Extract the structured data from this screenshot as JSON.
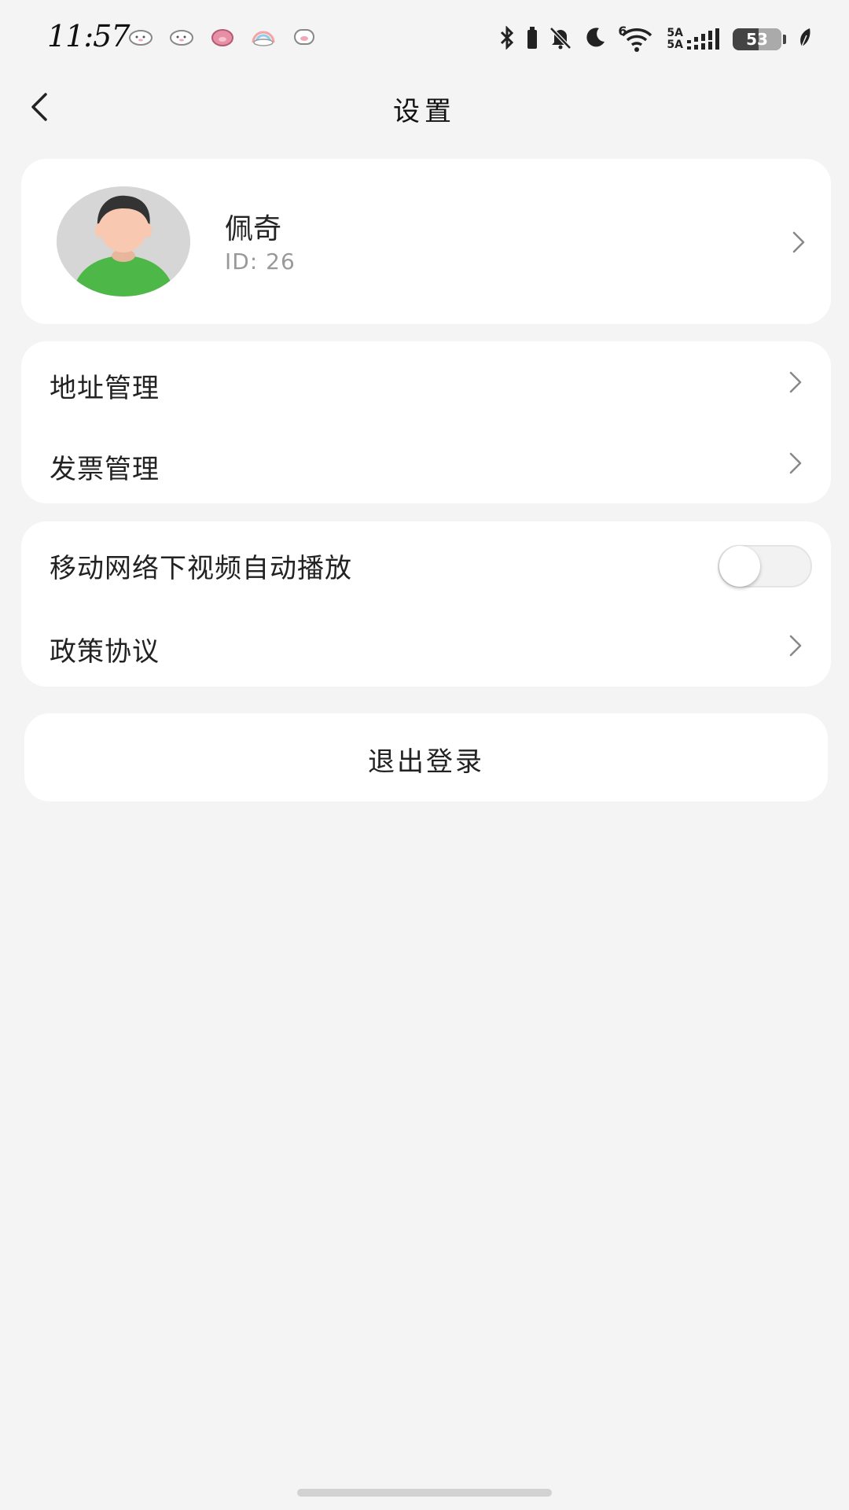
{
  "status_bar": {
    "time": "11:57",
    "battery_level": "53",
    "network_6": "6",
    "network_5a_top": "5A",
    "network_5a_bottom": "5A"
  },
  "header": {
    "title": "设置"
  },
  "profile": {
    "name": "佩奇",
    "id_text": "ID:  26"
  },
  "menu_group_1": {
    "items": [
      {
        "label": "地址管理"
      },
      {
        "label": "发票管理"
      }
    ]
  },
  "menu_group_2": {
    "autoplay_label": "移动网络下视频自动播放",
    "autoplay_enabled": false,
    "policy_label": "政策协议"
  },
  "logout": {
    "label": "退出登录"
  },
  "colors": {
    "background": "#f4f4f4",
    "card": "#ffffff",
    "text_primary": "#222222",
    "text_secondary": "#999999",
    "avatar_shirt": "#4db848",
    "avatar_skin": "#f8c9b0"
  }
}
